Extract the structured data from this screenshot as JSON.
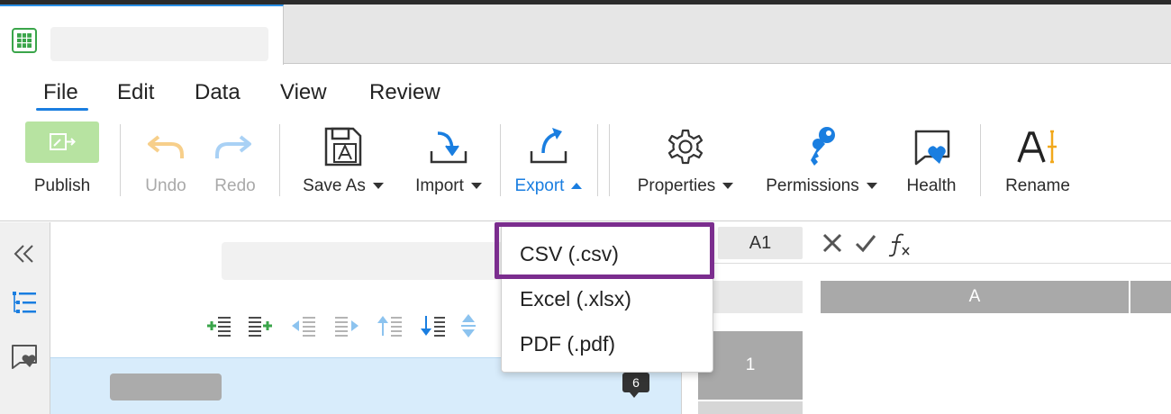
{
  "menu": {
    "file": "File",
    "edit": "Edit",
    "data": "Data",
    "view": "View",
    "review": "Review"
  },
  "ribbon": {
    "publish": "Publish",
    "undo": "Undo",
    "redo": "Redo",
    "save_as": "Save As",
    "import": "Import",
    "export": "Export",
    "properties": "Properties",
    "permissions": "Permissions",
    "health": "Health",
    "rename": "Rename"
  },
  "export_menu": {
    "items": [
      "CSV (.csv)",
      "Excel (.xlsx)",
      "PDF (.pdf)"
    ]
  },
  "panel": {
    "badge_count": "6"
  },
  "grid": {
    "name_box": "A1",
    "column_a": "A",
    "row_1": "1"
  },
  "colors": {
    "accent": "#1a7ee0",
    "publish_bg": "#b7e3a1",
    "highlight": "#7b2d8e"
  },
  "icons": [
    "spreadsheet-icon",
    "publish-icon",
    "undo-icon",
    "redo-icon",
    "save-as-icon",
    "import-icon",
    "export-icon",
    "gear-icon",
    "key-icon",
    "health-heart-icon",
    "rename-icon",
    "collapse-icon",
    "tree-list-icon",
    "heart-folder-icon",
    "cancel-icon",
    "check-icon",
    "function-icon"
  ]
}
